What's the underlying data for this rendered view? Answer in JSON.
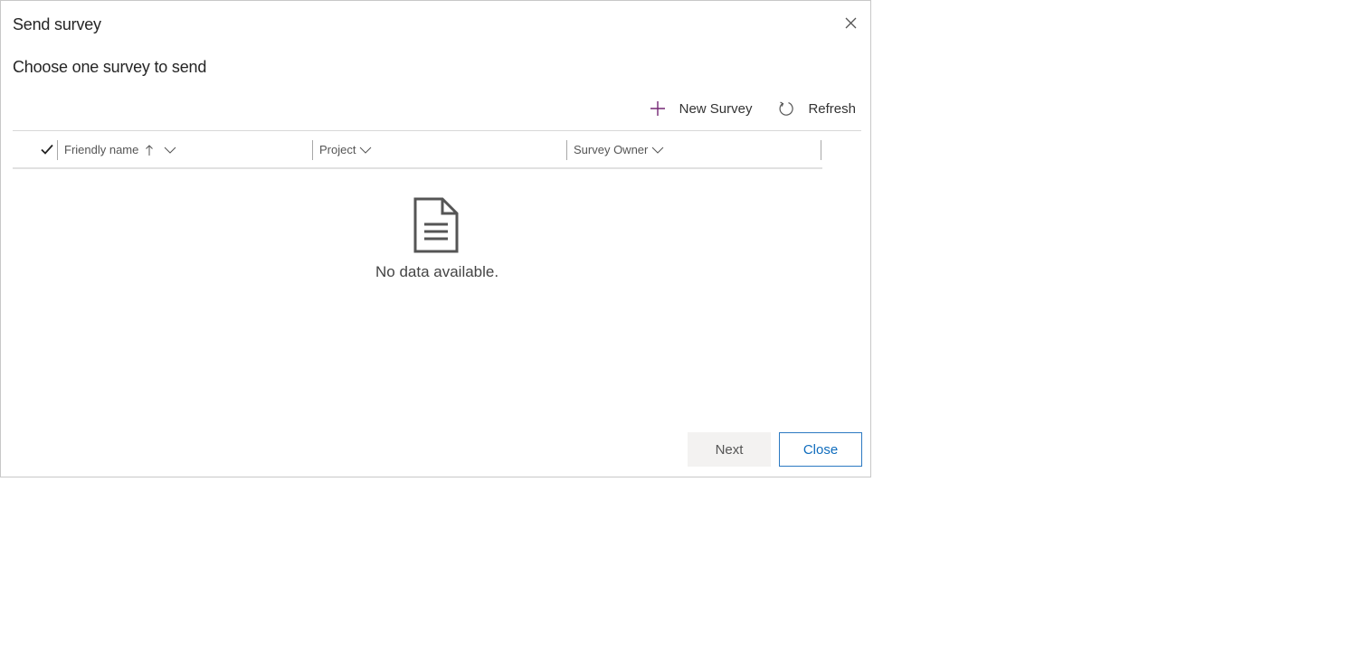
{
  "dialog": {
    "title": "Send survey",
    "subtitle": "Choose one survey to send"
  },
  "toolbar": {
    "new_label": "New Survey",
    "new_icon": "plus-icon",
    "refresh_label": "Refresh",
    "refresh_icon": "refresh-icon"
  },
  "grid": {
    "columns": [
      {
        "label": "Friendly name",
        "sort": "ascending"
      },
      {
        "label": "Project"
      },
      {
        "label": "Survey Owner"
      }
    ],
    "empty_text": "No data available.",
    "empty_icon": "document-icon"
  },
  "footer": {
    "next_label": "Next",
    "close_label": "Close"
  },
  "colors": {
    "accent": "#0f6cbd",
    "plus": "#742774"
  }
}
